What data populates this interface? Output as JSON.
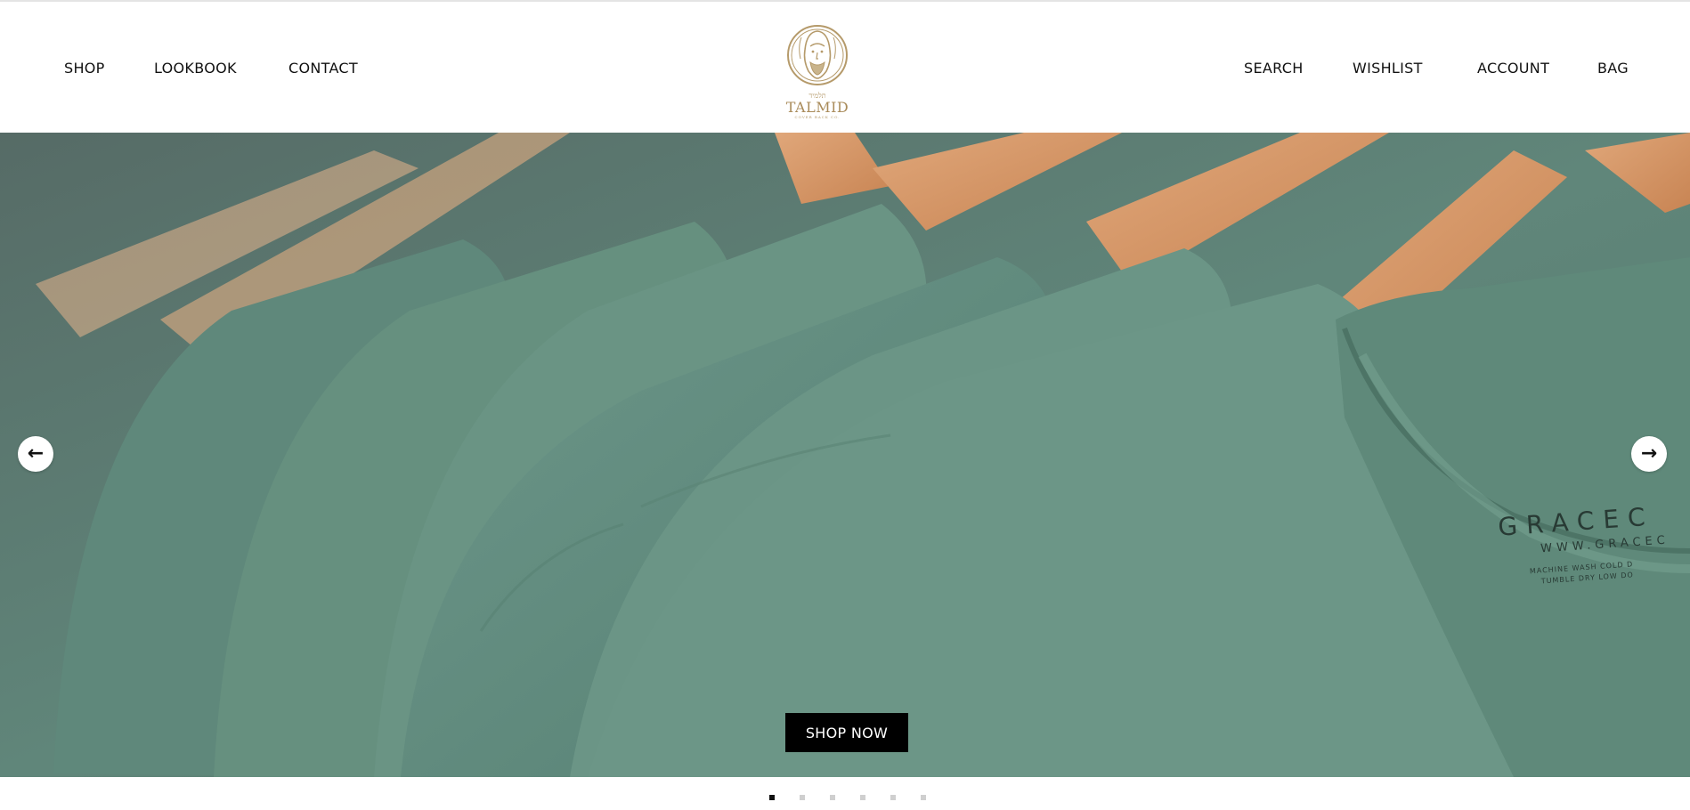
{
  "nav_left": [
    {
      "label": "SHOP"
    },
    {
      "label": "LOOKBOOK"
    },
    {
      "label": "CONTACT"
    }
  ],
  "nav_right": [
    {
      "label": "SEARCH"
    },
    {
      "label": "WISHLIST"
    },
    {
      "label": "ACCOUNT"
    },
    {
      "label": "BAG"
    }
  ],
  "logo": {
    "hebrew": "תלמיד",
    "name": "TALMID",
    "tagline": "COVER BACK CO.",
    "color": "#a98b5a"
  },
  "hero": {
    "background_color": "#5c8376",
    "garment_label_brand": "GRACEC",
    "garment_label_url": "WWW.GRACEC",
    "garment_label_care": [
      "MACHINE WASH COLD D",
      "TUMBLE DRY LOW DO"
    ],
    "prev_icon": "arrow-left-icon",
    "next_icon": "arrow-right-icon",
    "prev_glyph": "←",
    "next_glyph": "→",
    "cta_label": "SHOP NOW"
  },
  "carousel": {
    "slide_count": 6,
    "active_index": 0
  }
}
